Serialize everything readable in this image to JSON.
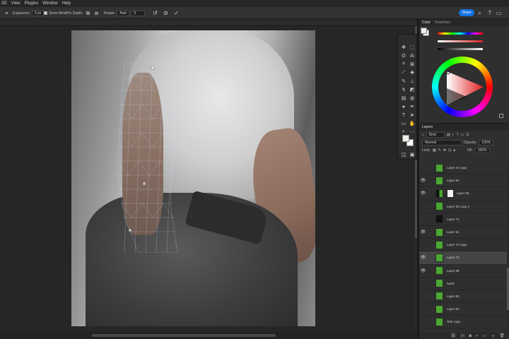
{
  "menu": [
    "3D",
    "View",
    "Plugins",
    "Window",
    "Help"
  ],
  "options": {
    "expansion_label": "Expansion:",
    "expansion_value": "2 px",
    "show_mesh_label": "Show Mesh",
    "pin_depth_label": "Pin Depth:",
    "rotate_label": "Rotate:",
    "rotate_mode": "Auto",
    "rotate_value": "0",
    "share_label": "Share"
  },
  "color_panel": {
    "tabs": [
      "Color",
      "Swatches"
    ],
    "foreground": "#f0ece8",
    "background": "#ffffff"
  },
  "layers_panel": {
    "tab": "Layers",
    "search_value": "Kind",
    "blend_mode": "Normal",
    "opacity_label": "Opacity:",
    "opacity_value": "100%",
    "lock_label": "Lock:",
    "fill_label": "Fill:",
    "fill_value": "100%",
    "layers": [
      {
        "name": "Layer 44 copy",
        "visible": false,
        "thumb": "green",
        "selected": false
      },
      {
        "name": "Layer 94",
        "visible": true,
        "thumb": "green",
        "selected": false
      },
      {
        "name": "Layer 56",
        "visible": true,
        "thumb": "mixed",
        "selected": false,
        "mask": true
      },
      {
        "name": "Layer 30 copy 2",
        "visible": false,
        "thumb": "green",
        "selected": false
      },
      {
        "name": "Layer 71",
        "visible": false,
        "thumb": "dark",
        "selected": false
      },
      {
        "name": "Layer 91",
        "visible": true,
        "thumb": "green",
        "selected": false
      },
      {
        "name": "Layer 73 copy",
        "visible": false,
        "thumb": "green",
        "selected": false
      },
      {
        "name": "Layer 73",
        "visible": true,
        "thumb": "green",
        "selected": true
      },
      {
        "name": "Layer 89",
        "visible": true,
        "thumb": "green",
        "selected": false
      },
      {
        "name": "hand",
        "visible": false,
        "thumb": "green",
        "selected": false
      },
      {
        "name": "Layer 65",
        "visible": false,
        "thumb": "green",
        "selected": false
      },
      {
        "name": "Layer 64",
        "visible": false,
        "thumb": "green",
        "selected": false
      },
      {
        "name": "Tele copy",
        "visible": false,
        "thumb": "green",
        "selected": false
      }
    ]
  },
  "icons": {
    "eye": "eye-icon",
    "search": "search-icon",
    "help": "help-icon",
    "undo": "undo-icon",
    "cancel": "cancel-icon",
    "commit": "check-icon"
  }
}
